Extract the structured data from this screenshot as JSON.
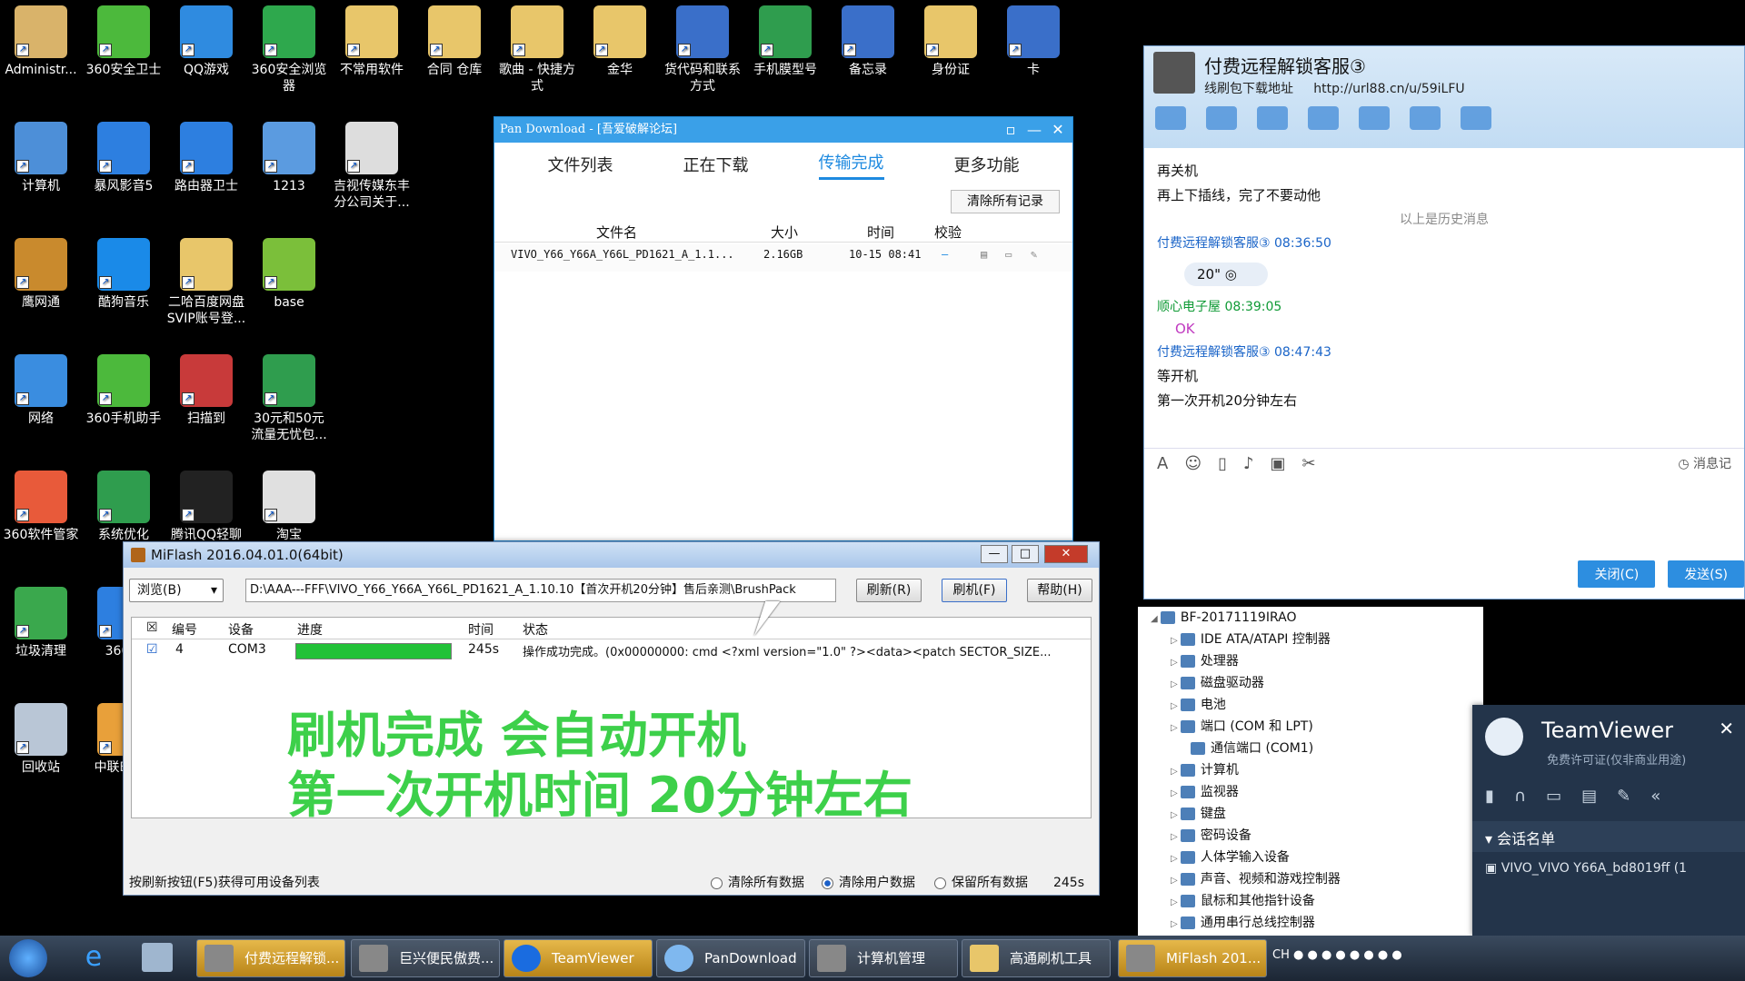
{
  "desktop_icons": [
    {
      "label": "Administr...",
      "color": "#d9b36a",
      "x": "admin"
    },
    {
      "label": "360安全卫士",
      "color": "#4cb93c"
    },
    {
      "label": "QQ游戏",
      "color": "#2f8be0"
    },
    {
      "label": "360安全浏览器",
      "color": "#2ea84d"
    },
    {
      "label": "不常用软件",
      "color": "#e8c66a"
    },
    {
      "label": "合同 仓库",
      "color": "#e8c66a"
    },
    {
      "label": "歌曲 - 快捷方式",
      "color": "#e8c66a"
    },
    {
      "label": "金华",
      "color": "#e8c66a"
    },
    {
      "label": "货代码和联系方式",
      "color": "#3a6fc9"
    },
    {
      "label": "手机膜型号",
      "color": "#2f9d4e"
    },
    {
      "label": "备忘录",
      "color": "#3a6fc9"
    },
    {
      "label": "身份证",
      "color": "#e8c66a"
    },
    {
      "label": "卡",
      "color": "#3a6fc9"
    },
    {
      "label": "计算机",
      "color": "#4d8fd8"
    },
    {
      "label": "暴风影音5",
      "color": "#2d7fe0"
    },
    {
      "label": "路由器卫士",
      "color": "#2d7fe0"
    },
    {
      "label": "1213",
      "color": "#5b9be0"
    },
    {
      "label": "吉视传媒东丰分公司关于...",
      "color": "#dddddd"
    },
    {
      "label": "鹰网通",
      "color": "#c98a2d"
    },
    {
      "label": "酷狗音乐",
      "color": "#1a8ae8"
    },
    {
      "label": "二哈百度网盘SVIP账号登...",
      "color": "#e8c66a"
    },
    {
      "label": "base",
      "color": "#7bbf3a"
    },
    {
      "label": "网络",
      "color": "#3a8de0"
    },
    {
      "label": "360手机助手",
      "color": "#4cb93c"
    },
    {
      "label": "扫描到",
      "color": "#c83a3a"
    },
    {
      "label": "30元和50元流量无忧包...",
      "color": "#2f9d4e"
    },
    {
      "label": "360软件管家",
      "color": "#e85a3a"
    },
    {
      "label": "系统优化",
      "color": "#2f9d4e"
    },
    {
      "label": "腾讯QQ轻聊",
      "color": "#222222"
    },
    {
      "label": "淘宝",
      "color": "#e0e0e0"
    },
    {
      "label": "垃圾清理",
      "color": "#3aa84d"
    },
    {
      "label": "360极",
      "color": "#2d7fe0"
    },
    {
      "label": "回收站",
      "color": "#b9c6d6"
    },
    {
      "label": "中联E服务",
      "color": "#e8a03a"
    }
  ],
  "pan": {
    "title": "Pan Download - [吾爱破解论坛]",
    "tabs": [
      "文件列表",
      "正在下载",
      "传输完成",
      "更多功能"
    ],
    "active_tab": "传输完成",
    "clear_btn": "清除所有记录",
    "headers": [
      "文件名",
      "大小",
      "时间",
      "校验"
    ],
    "row": {
      "name": "VIVO_Y66_Y66A_Y66L_PD1621_A_1.1...",
      "size": "2.16GB",
      "time": "10-15 08:41",
      "check": "—"
    }
  },
  "chat": {
    "title": "付费远程解锁客服③",
    "sub_label": "线刷包下载地址",
    "sub_url": "http://url88.cn/u/59iLFU",
    "messages": [
      {
        "type": "text",
        "text": "再关机"
      },
      {
        "type": "text",
        "text": "再上下插线，完了不要动他"
      },
      {
        "type": "divider",
        "text": "以上是历史消息"
      },
      {
        "type": "sender",
        "text": "付费远程解锁客服③  08:36:50"
      },
      {
        "type": "voice",
        "text": "20\""
      },
      {
        "type": "sender2",
        "text": "顺心电子屋  08:39:05"
      },
      {
        "type": "ok",
        "text": "OK"
      },
      {
        "type": "sender",
        "text": "付费远程解锁客服③  08:47:43"
      },
      {
        "type": "text",
        "text": "等开机"
      },
      {
        "type": "text",
        "text": "第一次开机20分钟左右"
      }
    ],
    "msg_record": "消息记",
    "close_btn": "关闭(C)",
    "send_btn": "发送(S)"
  },
  "devmgr": {
    "items": [
      {
        "label": "BF-20171119IRAO",
        "indent": 0
      },
      {
        "label": "IDE ATA/ATAPI 控制器",
        "indent": 1
      },
      {
        "label": "处理器",
        "indent": 1
      },
      {
        "label": "磁盘驱动器",
        "indent": 1
      },
      {
        "label": "电池",
        "indent": 1
      },
      {
        "label": "端口 (COM 和 LPT)",
        "indent": 1
      },
      {
        "label": "通信端口 (COM1)",
        "indent": 2
      },
      {
        "label": "计算机",
        "indent": 1
      },
      {
        "label": "监视器",
        "indent": 1
      },
      {
        "label": "键盘",
        "indent": 1
      },
      {
        "label": "密码设备",
        "indent": 1
      },
      {
        "label": "人体学输入设备",
        "indent": 1
      },
      {
        "label": "声音、视频和游戏控制器",
        "indent": 1
      },
      {
        "label": "鼠标和其他指针设备",
        "indent": 1
      },
      {
        "label": "通用串行总线控制器",
        "indent": 1
      }
    ]
  },
  "teamviewer": {
    "title": "TeamViewer",
    "sub": "免费许可证(仅非商业用途)",
    "section": "会话名单",
    "session": "VIVO_VIVO Y66A_bd8019ff (1"
  },
  "miflash": {
    "title": "MiFlash 2016.04.01.0(64bit)",
    "browse": "浏览(B)",
    "path": "D:\\AAA---FFF\\VIVO_Y66_Y66A_Y66L_PD1621_A_1.10.10【首次开机20分钟】售后亲测\\BrushPack",
    "refresh": "刷新(R)",
    "flash": "刷机(F)",
    "help": "帮助(H)",
    "headers": [
      "编号",
      "设备",
      "进度",
      "时间",
      "状态"
    ],
    "row": {
      "num": "4",
      "device": "COM3",
      "progress": 1.0,
      "time": "245s",
      "status": "操作成功完成。(0x00000000: cmd <?xml version=\"1.0\" ?><data><patch SECTOR_SIZE..."
    },
    "big_line1": "刷机完成 会自动开机",
    "big_line2": "第一次开机时间 20分钟左右",
    "hint": "按刷新按钮(F5)获得可用设备列表",
    "opt1": "清除所有数据",
    "opt2": "清除用户数据",
    "opt3": "保留所有数据",
    "elapsed": "245s"
  },
  "taskbar": {
    "items": [
      "付费远程解锁...",
      "巨兴便民傲费...",
      "TeamViewer",
      "PanDownload",
      "计算机管理",
      "高通刷机工具",
      "MiFlash 201..."
    ],
    "tray": "CH"
  }
}
